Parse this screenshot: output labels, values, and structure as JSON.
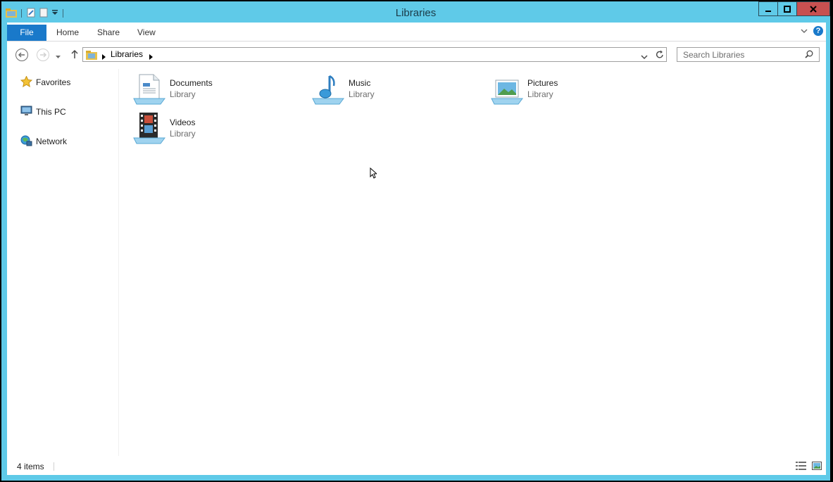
{
  "window": {
    "title": "Libraries"
  },
  "ribbon": {
    "tabs": [
      "File",
      "Home",
      "Share",
      "View"
    ]
  },
  "address": {
    "crumbs": [
      "Libraries"
    ]
  },
  "search": {
    "placeholder": "Search Libraries"
  },
  "nav": {
    "items": [
      {
        "label": "Favorites",
        "icon": "star-icon"
      },
      {
        "label": "This PC",
        "icon": "computer-icon"
      },
      {
        "label": "Network",
        "icon": "network-icon"
      }
    ]
  },
  "libraries": [
    {
      "name": "Documents",
      "type": "Library",
      "icon": "documents-library-icon"
    },
    {
      "name": "Music",
      "type": "Library",
      "icon": "music-library-icon"
    },
    {
      "name": "Pictures",
      "type": "Library",
      "icon": "pictures-library-icon"
    },
    {
      "name": "Videos",
      "type": "Library",
      "icon": "videos-library-icon"
    }
  ],
  "status": {
    "item_count": "4 items"
  },
  "colors": {
    "frame": "#5fcae8",
    "accent": "#1979ca",
    "close": "#c75050"
  }
}
